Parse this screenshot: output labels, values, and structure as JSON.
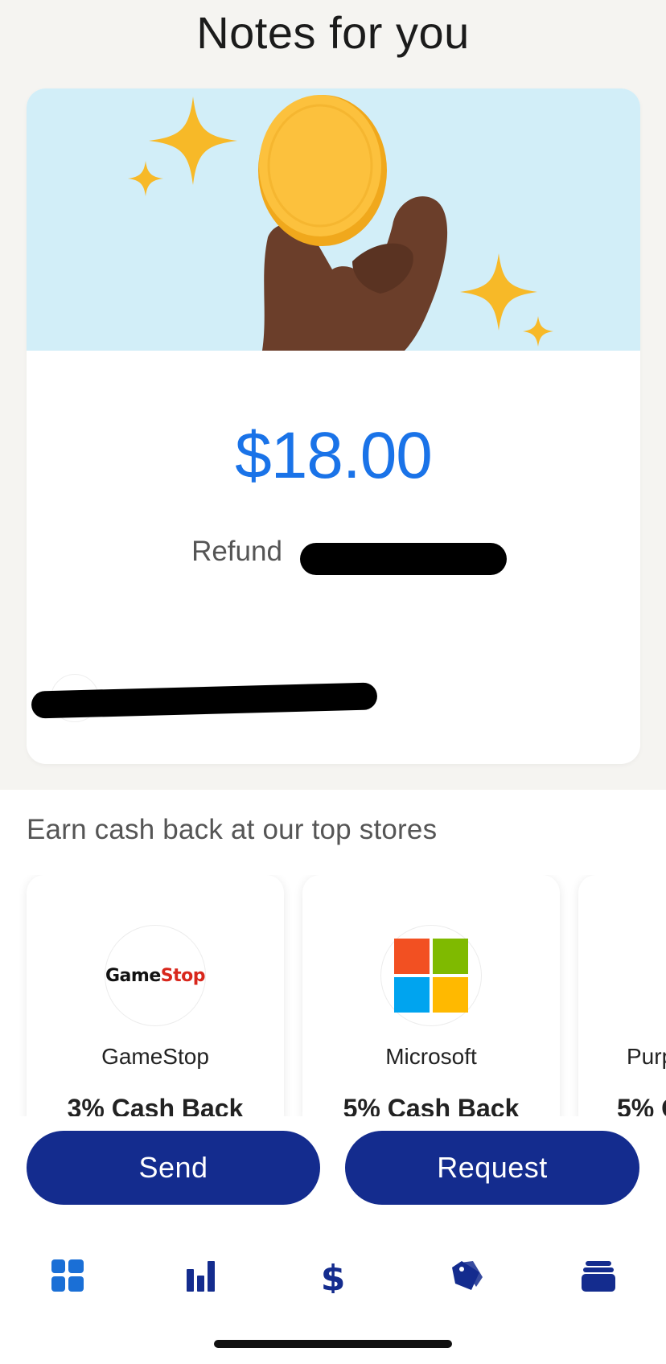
{
  "page_title": "Notes for you",
  "note_card": {
    "amount": "$18.00",
    "refund_label": "Refund"
  },
  "cashback_section": {
    "title": "Earn cash back at our top stores",
    "stores": [
      {
        "name": "GameStop",
        "cashback": "3% Cash Back",
        "logo_text": "GameStop"
      },
      {
        "name": "Microsoft",
        "cashback": "5% Cash Back"
      },
      {
        "name": "Purp",
        "cashback": "5% C"
      }
    ]
  },
  "actions": {
    "send_label": "Send",
    "request_label": "Request"
  },
  "nav": {
    "items": [
      {
        "icon": "home-grid-icon",
        "active": true
      },
      {
        "icon": "activity-bars-icon"
      },
      {
        "icon": "dollar-icon"
      },
      {
        "icon": "deals-tag-icon"
      },
      {
        "icon": "wallet-cards-icon"
      }
    ]
  },
  "colors": {
    "accent_blue": "#1a73e8",
    "button_navy": "#142c8e",
    "hero_bg": "#d2eef8",
    "coin_gold": "#f6b93b"
  }
}
